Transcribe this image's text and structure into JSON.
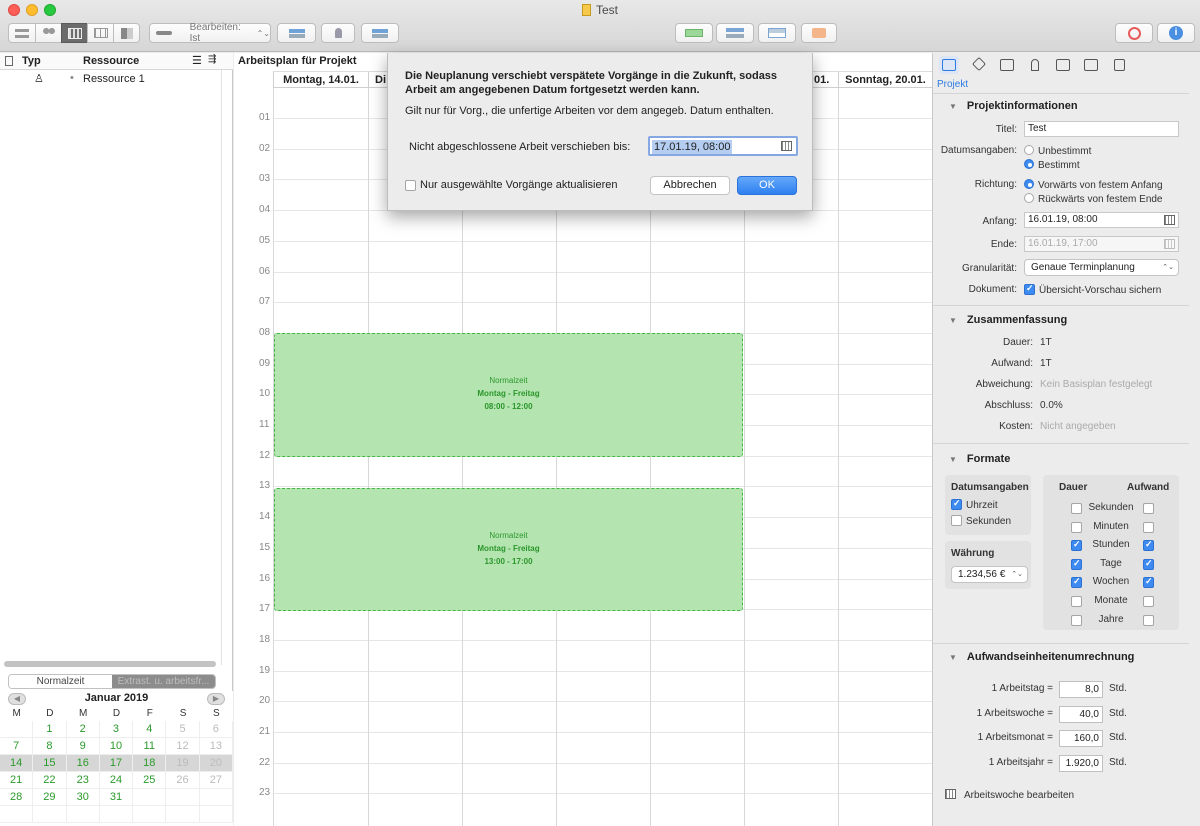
{
  "window": {
    "title": "Test"
  },
  "toolbar": {
    "edit_select": "Bearbeiten: Ist"
  },
  "resources": {
    "col_type": "Typ",
    "col_resource": "Ressource",
    "rows": [
      {
        "name": "Ressource 1"
      }
    ]
  },
  "calendar_tabs": {
    "normal": "Normalzeit",
    "extra": "Extrast. u. arbeitsfr..."
  },
  "mini_calendar": {
    "month_label": "Januar 2019",
    "prev": "◀",
    "next": "▶",
    "weekday_heads": [
      "M",
      "D",
      "M",
      "D",
      "F",
      "S",
      "S"
    ],
    "weeks": [
      [
        "",
        "1",
        "2",
        "3",
        "4",
        "5",
        "6"
      ],
      [
        "7",
        "8",
        "9",
        "10",
        "11",
        "12",
        "13"
      ],
      [
        "14",
        "15",
        "16",
        "17",
        "18",
        "19",
        "20"
      ],
      [
        "21",
        "22",
        "23",
        "24",
        "25",
        "26",
        "27"
      ],
      [
        "28",
        "29",
        "30",
        "31",
        "",
        "",
        ""
      ],
      [
        "",
        "",
        "",
        "",
        "",
        "",
        ""
      ]
    ],
    "selected_week_index": 2
  },
  "plan": {
    "title": "Arbeitsplan für Projekt",
    "day_headers": [
      "Montag, 14.01.",
      "Di",
      "",
      "",
      "",
      "01.",
      "Sonntag, 20.01."
    ],
    "hours": [
      "01",
      "02",
      "03",
      "04",
      "05",
      "06",
      "07",
      "08",
      "09",
      "10",
      "11",
      "12",
      "13",
      "14",
      "15",
      "16",
      "17",
      "18",
      "19",
      "20",
      "21",
      "22",
      "23"
    ],
    "blocks": [
      {
        "title": "Normalzeit",
        "days": "Montag - Freitag",
        "time": "08:00 - 12:00"
      },
      {
        "title": "Normalzeit",
        "days": "Montag - Freitag",
        "time": "13:00 - 17:00"
      }
    ]
  },
  "dialog": {
    "message": "Die Neuplanung verschiebt verspätete Vorgänge in die Zukunft, sodass Arbeit am angegebenen Datum fortgesetzt werden kann.",
    "info": "Gilt nur für Vorg., die unfertige Arbeiten vor dem angegeb. Datum enthalten.",
    "date_label": "Nicht abgeschlossene Arbeit verschieben bis:",
    "date_value": "17.01.19, 08:00",
    "checkbox_label": "Nur ausgewählte Vorgänge aktualisieren",
    "checkbox_checked": false,
    "cancel": "Abbrechen",
    "ok": "OK"
  },
  "inspector": {
    "tab_label": "Projekt",
    "project_info": {
      "heading": "Projektinformationen",
      "title_label": "Titel:",
      "title_value": "Test",
      "dates_label": "Datumsangaben:",
      "dates_options": [
        "Unbestimmt",
        "Bestimmt"
      ],
      "dates_selected": 1,
      "direction_label": "Richtung:",
      "direction_options": [
        "Vorwärts von festem Anfang",
        "Rückwärts von festem Ende"
      ],
      "direction_selected": 0,
      "start_label": "Anfang:",
      "start_value": "16.01.19, 08:00",
      "end_label": "Ende:",
      "end_value": "16.01.19, 17:00",
      "granularity_label": "Granularität:",
      "granularity_value": "Genaue Terminplanung",
      "document_label": "Dokument:",
      "document_checkbox": "Übersicht-Vorschau sichern",
      "document_checked": true
    },
    "summary": {
      "heading": "Zusammenfassung",
      "duration_label": "Dauer:",
      "duration_value": "1T",
      "effort_label": "Aufwand:",
      "effort_value": "1T",
      "variance_label": "Abweichung:",
      "variance_value": "Kein Basisplan festgelegt",
      "completion_label": "Abschluss:",
      "completion_value": "0.0%",
      "costs_label": "Kosten:",
      "costs_value": "Nicht angegeben"
    },
    "formats": {
      "heading": "Formate",
      "dates_heading": "Datumsangaben",
      "dates_time": {
        "label": "Uhrzeit",
        "checked": true
      },
      "dates_seconds": {
        "label": "Sekunden",
        "checked": false
      },
      "currency_heading": "Währung",
      "currency_value": "1.234,56 €",
      "units_head_duration": "Dauer",
      "units_head_effort": "Aufwand",
      "units": [
        {
          "label": "Sekunden",
          "duration": false,
          "effort": false
        },
        {
          "label": "Minuten",
          "duration": false,
          "effort": false
        },
        {
          "label": "Stunden",
          "duration": true,
          "effort": true
        },
        {
          "label": "Tage",
          "duration": true,
          "effort": true
        },
        {
          "label": "Wochen",
          "duration": true,
          "effort": true
        },
        {
          "label": "Monate",
          "duration": false,
          "effort": false
        },
        {
          "label": "Jahre",
          "duration": false,
          "effort": false
        }
      ]
    },
    "conversion": {
      "heading": "Aufwandseinheitenumrechnung",
      "rows": [
        {
          "label": "1 Arbeitstag =",
          "value": "8,0",
          "unit": "Std."
        },
        {
          "label": "1 Arbeitswoche =",
          "value": "40,0",
          "unit": "Std."
        },
        {
          "label": "1 Arbeitsmonat =",
          "value": "160,0",
          "unit": "Std."
        },
        {
          "label": "1 Arbeitsjahr =",
          "value": "1.920,0",
          "unit": "Std."
        }
      ],
      "edit_week": "Arbeitswoche bearbeiten"
    }
  }
}
